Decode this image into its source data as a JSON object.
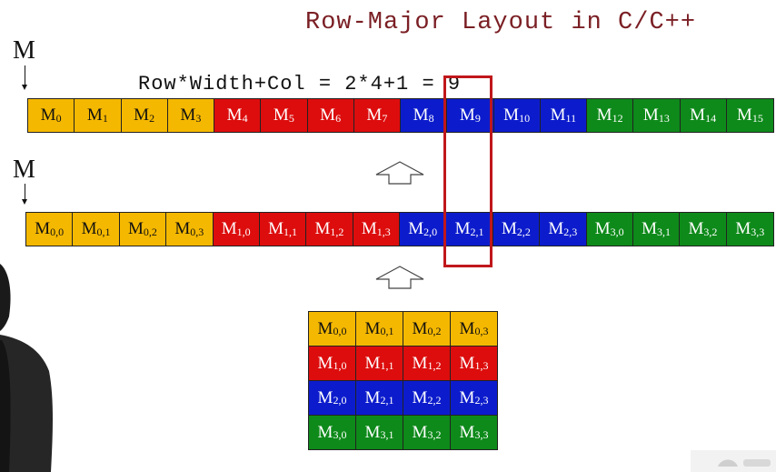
{
  "title": "Row-Major Layout in C/C++",
  "formula": "Row*Width+Col = 2*4+1 = 9",
  "matrix_label": "M",
  "colors": {
    "yellow": "#f5b800",
    "red": "#dd0d0d",
    "blue": "#0c1ccc",
    "green": "#0e8a1a",
    "highlight": "#c0171c",
    "title": "#7a1f24"
  },
  "linear_row": [
    {
      "base": "M",
      "sub": "0",
      "color": "yellow"
    },
    {
      "base": "M",
      "sub": "1",
      "color": "yellow"
    },
    {
      "base": "M",
      "sub": "2",
      "color": "yellow"
    },
    {
      "base": "M",
      "sub": "3",
      "color": "yellow"
    },
    {
      "base": "M",
      "sub": "4",
      "color": "red"
    },
    {
      "base": "M",
      "sub": "5",
      "color": "red"
    },
    {
      "base": "M",
      "sub": "6",
      "color": "red"
    },
    {
      "base": "M",
      "sub": "7",
      "color": "red"
    },
    {
      "base": "M",
      "sub": "8",
      "color": "blue"
    },
    {
      "base": "M",
      "sub": "9",
      "color": "blue"
    },
    {
      "base": "M",
      "sub": "10",
      "color": "blue"
    },
    {
      "base": "M",
      "sub": "11",
      "color": "blue"
    },
    {
      "base": "M",
      "sub": "12",
      "color": "green"
    },
    {
      "base": "M",
      "sub": "13",
      "color": "green"
    },
    {
      "base": "M",
      "sub": "14",
      "color": "green"
    },
    {
      "base": "M",
      "sub": "15",
      "color": "green"
    }
  ],
  "indexed_row": [
    {
      "base": "M",
      "sub": "0,0",
      "color": "yellow"
    },
    {
      "base": "M",
      "sub": "0,1",
      "color": "yellow"
    },
    {
      "base": "M",
      "sub": "0,2",
      "color": "yellow"
    },
    {
      "base": "M",
      "sub": "0,3",
      "color": "yellow"
    },
    {
      "base": "M",
      "sub": "1,0",
      "color": "red"
    },
    {
      "base": "M",
      "sub": "1,1",
      "color": "red"
    },
    {
      "base": "M",
      "sub": "1,2",
      "color": "red"
    },
    {
      "base": "M",
      "sub": "1,3",
      "color": "red"
    },
    {
      "base": "M",
      "sub": "2,0",
      "color": "blue"
    },
    {
      "base": "M",
      "sub": "2,1",
      "color": "blue"
    },
    {
      "base": "M",
      "sub": "2,2",
      "color": "blue"
    },
    {
      "base": "M",
      "sub": "2,3",
      "color": "blue"
    },
    {
      "base": "M",
      "sub": "3,0",
      "color": "green"
    },
    {
      "base": "M",
      "sub": "3,1",
      "color": "green"
    },
    {
      "base": "M",
      "sub": "3,2",
      "color": "green"
    },
    {
      "base": "M",
      "sub": "3,3",
      "color": "green"
    }
  ],
  "matrix_grid": [
    [
      {
        "base": "M",
        "sub": "0,0"
      },
      {
        "base": "M",
        "sub": "0,1"
      },
      {
        "base": "M",
        "sub": "0,2"
      },
      {
        "base": "M",
        "sub": "0,3"
      }
    ],
    [
      {
        "base": "M",
        "sub": "1,0"
      },
      {
        "base": "M",
        "sub": "1,1"
      },
      {
        "base": "M",
        "sub": "1,2"
      },
      {
        "base": "M",
        "sub": "1,3"
      }
    ],
    [
      {
        "base": "M",
        "sub": "2,0"
      },
      {
        "base": "M",
        "sub": "2,1"
      },
      {
        "base": "M",
        "sub": "2,2"
      },
      {
        "base": "M",
        "sub": "2,3"
      }
    ],
    [
      {
        "base": "M",
        "sub": "3,0"
      },
      {
        "base": "M",
        "sub": "3,1"
      },
      {
        "base": "M",
        "sub": "3,2"
      },
      {
        "base": "M",
        "sub": "3,3"
      }
    ]
  ],
  "grid_row_colors": [
    "yellow",
    "red",
    "blue",
    "green"
  ],
  "highlighted_element": {
    "linear_index": 9,
    "row": 2,
    "col": 1
  }
}
